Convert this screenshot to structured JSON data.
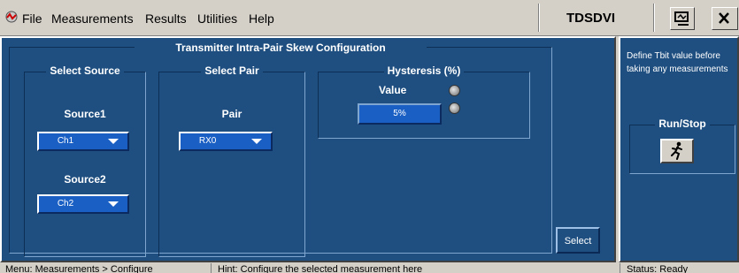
{
  "menubar": {
    "items": [
      "File",
      "Measurements",
      "Results",
      "Utilities",
      "Help"
    ],
    "app_title": "TDSDVI"
  },
  "main": {
    "group_title": "Transmitter Intra-Pair Skew Configuration",
    "select_source": {
      "title": "Select Source",
      "source1_label": "Source1",
      "source1_value": "Ch1",
      "source2_label": "Source2",
      "source2_value": "Ch2"
    },
    "select_pair": {
      "title": "Select Pair",
      "pair_label": "Pair",
      "pair_value": "RX0"
    },
    "hysteresis": {
      "title": "Hysteresis (%)",
      "value_label": "Value",
      "value": "5%"
    },
    "select_button": "Select"
  },
  "side": {
    "info_text": "Define Tbit value before taking any measurements",
    "run_stop_title": "Run/Stop"
  },
  "status_bar": {
    "menu_path": "Menu: Measurements > Configure",
    "hint": "Hint: Configure the selected measurement here",
    "status": "Status: Ready"
  },
  "colors": {
    "panel_bg": "#1f4f80",
    "combo_bg": "#1a5fc4",
    "chrome": "#d4d0c8"
  }
}
